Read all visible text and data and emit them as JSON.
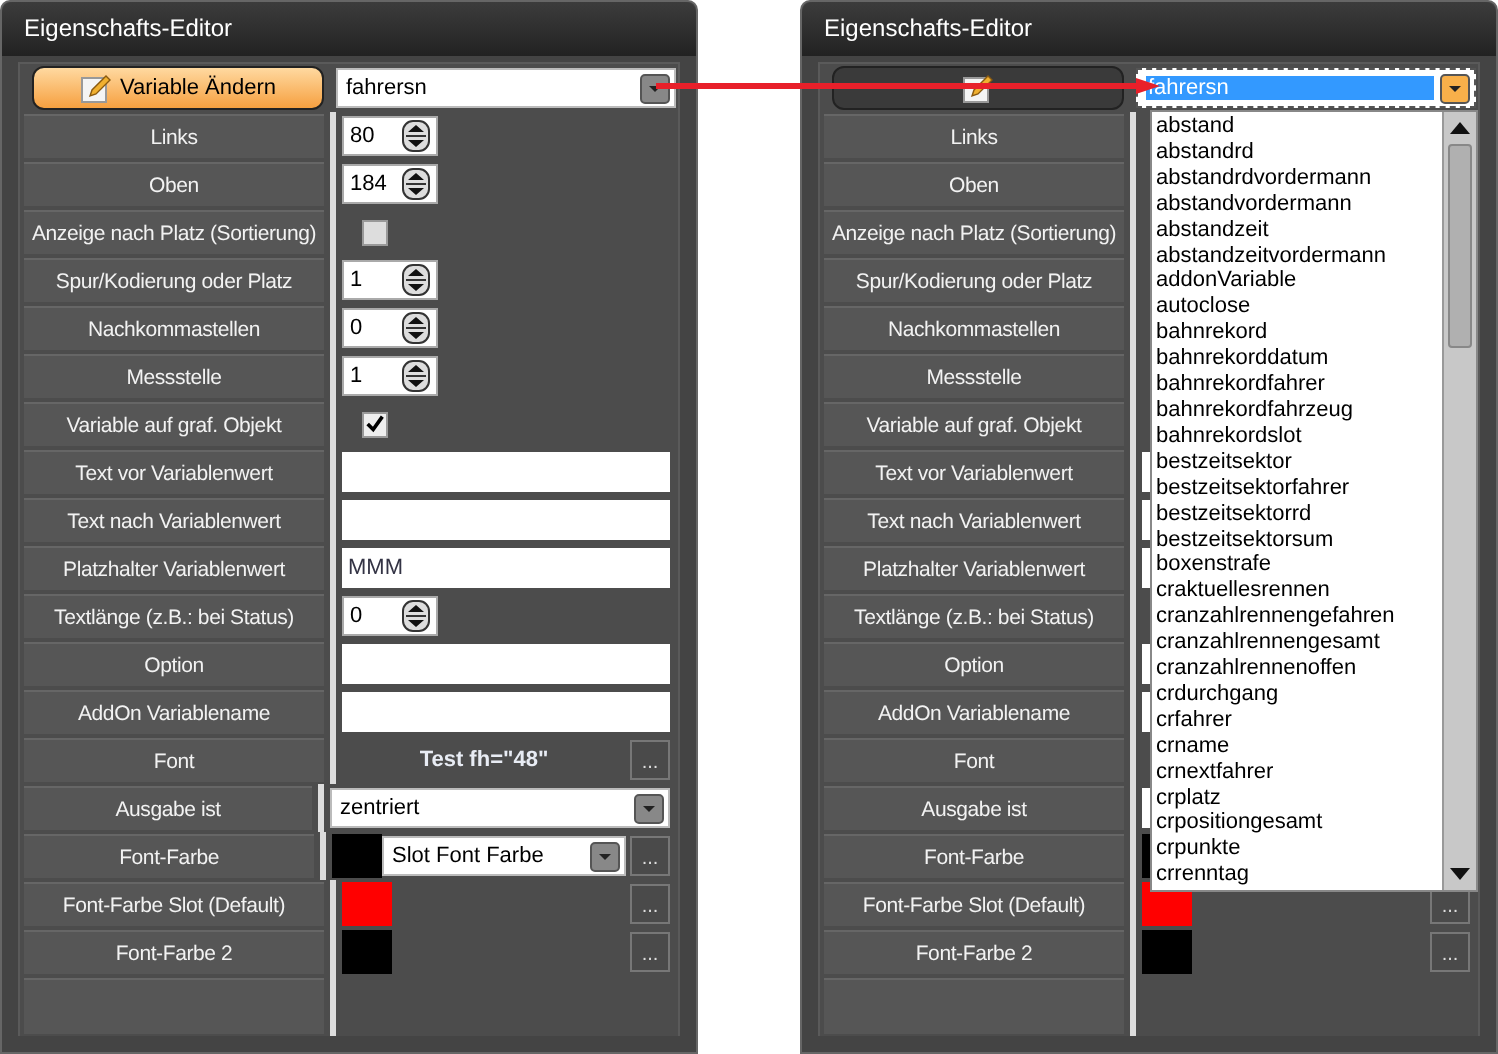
{
  "panels": [
    {
      "title": "Eigenschafts-Editor",
      "button": {
        "label": "Variable Ändern",
        "highlighted": true
      },
      "rows": [
        {
          "kind": "combo",
          "value": "fahrersn",
          "focused": false
        },
        {
          "kind": "spin",
          "label": "Links",
          "value": "80"
        },
        {
          "kind": "spin",
          "label": "Oben",
          "value": "184"
        },
        {
          "kind": "checkbox",
          "label": "Anzeige nach Platz (Sortierung)",
          "checked": false
        },
        {
          "kind": "spin",
          "label": "Spur/Kodierung oder Platz",
          "value": "1"
        },
        {
          "kind": "spin",
          "label": "Nachkommastellen",
          "value": "0"
        },
        {
          "kind": "spin",
          "label": "Messstelle",
          "value": "1"
        },
        {
          "kind": "checkbox",
          "label": "Variable auf graf. Objekt",
          "checked": true
        },
        {
          "kind": "text",
          "label": "Text vor Variablenwert"
        },
        {
          "kind": "text",
          "label": "Text nach Variablenwert"
        },
        {
          "kind": "text",
          "label": "Platzhalter Variablenwert",
          "value": "MMM"
        },
        {
          "kind": "spin",
          "label": "Textlänge (z.B.: bei Status)",
          "value": "0"
        },
        {
          "kind": "text",
          "label": "Option"
        },
        {
          "kind": "text",
          "label": "AddOn Variablename"
        },
        {
          "kind": "font",
          "label": "Font",
          "value": "Test fh=\"48\"",
          "more": "..."
        },
        {
          "kind": "combo",
          "label": "Ausgabe ist",
          "value": "zentriert",
          "focused": false
        },
        {
          "kind": "color",
          "label": "Font-Farbe",
          "color": "#000000",
          "combo": "Slot Font Farbe",
          "more": "..."
        },
        {
          "kind": "color",
          "label": "Font-Farbe Slot (Default)",
          "color": "#ff0000",
          "more": "..."
        },
        {
          "kind": "color",
          "label": "Font-Farbe 2",
          "color": "#000000",
          "more": "..."
        }
      ]
    },
    {
      "title": "Eigenschafts-Editor",
      "button": {
        "highlighted": false
      },
      "rows": [
        {
          "kind": "combo",
          "value": "fahrersn",
          "focused": true
        },
        {
          "kind": "covered",
          "label": "Links"
        },
        {
          "kind": "covered",
          "label": "Oben"
        },
        {
          "kind": "covered",
          "label": "Anzeige nach Platz (Sortierung)"
        },
        {
          "kind": "covered",
          "label": "Spur/Kodierung oder Platz"
        },
        {
          "kind": "covered",
          "label": "Nachkommastellen"
        },
        {
          "kind": "covered",
          "label": "Messstelle"
        },
        {
          "kind": "covered",
          "label": "Variable auf graf. Objekt"
        },
        {
          "kind": "text",
          "label": "Text vor Variablenwert"
        },
        {
          "kind": "text",
          "label": "Text nach Variablenwert"
        },
        {
          "kind": "text",
          "label": "Platzhalter Variablenwert"
        },
        {
          "kind": "covered",
          "label": "Textlänge (z.B.: bei Status)"
        },
        {
          "kind": "text",
          "label": "Option"
        },
        {
          "kind": "text",
          "label": "AddOn Variablename"
        },
        {
          "kind": "covered",
          "label": "Font"
        },
        {
          "kind": "text",
          "label": "Ausgabe ist"
        },
        {
          "kind": "color",
          "label": "Font-Farbe",
          "color": "#000000"
        },
        {
          "kind": "color",
          "label": "Font-Farbe Slot (Default)",
          "color": "#ff0000",
          "more": "..."
        },
        {
          "kind": "color",
          "label": "Font-Farbe 2",
          "color": "#000000",
          "more": "..."
        }
      ],
      "dropdown_list": [
        "abstand",
        "abstandrd",
        "abstandrdvordermann",
        "abstandvordermann",
        "abstandzeit",
        "abstandzeitvordermann",
        "addonVariable",
        "autoclose",
        "bahnrekord",
        "bahnrekorddatum",
        "bahnrekordfahrer",
        "bahnrekordfahrzeug",
        "bahnrekordslot",
        "bestzeitsektor",
        "bestzeitsektorfahrer",
        "bestzeitsektorrd",
        "bestzeitsektorsum",
        "boxenstrafe",
        "craktuellesrennen",
        "cranzahlrennengefahren",
        "cranzahlrennengesamt",
        "cranzahlrennenoffen",
        "crdurchgang",
        "crfahrer",
        "crname",
        "crnextfahrer",
        "crplatz",
        "crpositiongesamt",
        "crpunkte",
        "crrenntag"
      ]
    }
  ]
}
